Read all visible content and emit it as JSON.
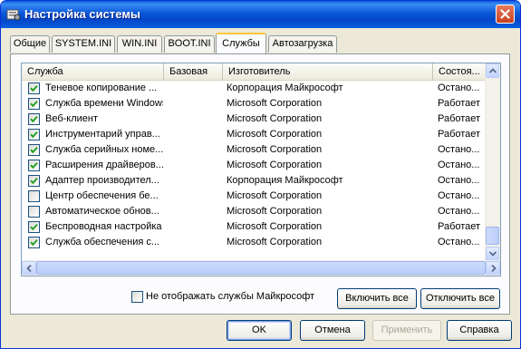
{
  "window": {
    "title": "Настройка системы"
  },
  "tabs": [
    {
      "label": "Общие"
    },
    {
      "label": "SYSTEM.INI"
    },
    {
      "label": "WIN.INI"
    },
    {
      "label": "BOOT.INI"
    },
    {
      "label": "Службы"
    },
    {
      "label": "Автозагрузка"
    }
  ],
  "active_tab": "Службы",
  "columns": [
    "Служба",
    "Базовая",
    "Изготовитель",
    "Состоя..."
  ],
  "rows": [
    {
      "checked": true,
      "service": "Теневое копирование ...",
      "basic": "",
      "vendor": "Корпорация Майкрософт",
      "status": "Остано..."
    },
    {
      "checked": true,
      "service": "Служба времени Windows",
      "basic": "",
      "vendor": "Microsoft Corporation",
      "status": "Работает"
    },
    {
      "checked": true,
      "service": "Веб-клиент",
      "basic": "",
      "vendor": "Microsoft Corporation",
      "status": "Работает"
    },
    {
      "checked": true,
      "service": "Инструментарий управ...",
      "basic": "",
      "vendor": "Microsoft Corporation",
      "status": "Работает"
    },
    {
      "checked": true,
      "service": "Служба серийных номе...",
      "basic": "",
      "vendor": "Microsoft Corporation",
      "status": "Остано..."
    },
    {
      "checked": true,
      "service": "Расширения драйверов...",
      "basic": "",
      "vendor": "Microsoft Corporation",
      "status": "Остано..."
    },
    {
      "checked": true,
      "service": "Адаптер производител...",
      "basic": "",
      "vendor": "Корпорация Майкрософт",
      "status": "Остано..."
    },
    {
      "checked": false,
      "service": "Центр обеспечения бе...",
      "basic": "",
      "vendor": "Microsoft Corporation",
      "status": "Остано..."
    },
    {
      "checked": false,
      "service": "Автоматическое обнов...",
      "basic": "",
      "vendor": "Microsoft Corporation",
      "status": "Остано..."
    },
    {
      "checked": true,
      "service": "Беспроводная настройка",
      "basic": "",
      "vendor": "Microsoft Corporation",
      "status": "Работает"
    },
    {
      "checked": true,
      "service": "Служба обеспечения с...",
      "basic": "",
      "vendor": "Microsoft Corporation",
      "status": "Остано..."
    }
  ],
  "hide_ms": {
    "label": "Не отображать службы Майкрософт",
    "checked": false
  },
  "buttons": {
    "enable_all": "Включить все",
    "disable_all": "Отключить все",
    "ok": "OK",
    "cancel": "Отмена",
    "apply": "Применить",
    "help": "Справка"
  },
  "colors": {
    "title_bar": "#0A58D8",
    "dialog_bg": "#ECE9D8",
    "tab_highlight": "#FFC83C",
    "scroll_blue": "#C2D3FC"
  }
}
